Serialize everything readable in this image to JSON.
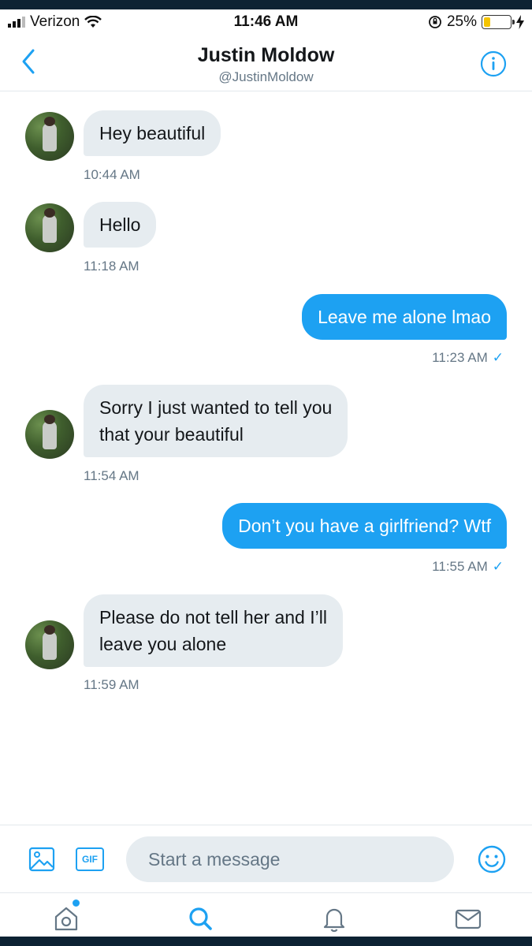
{
  "status_bar": {
    "carrier": "Verizon",
    "time": "11:46 AM",
    "battery": "25%",
    "battery_level": 0.25
  },
  "header": {
    "name": "Justin Moldow",
    "handle": "@JustinMoldow"
  },
  "messages": [
    {
      "direction": "in",
      "text_lines": [
        "Hey beautiful"
      ],
      "time": "10:44 AM"
    },
    {
      "direction": "in",
      "text_lines": [
        "Hello"
      ],
      "time": "11:18 AM"
    },
    {
      "direction": "out",
      "text_lines": [
        "Leave me alone lmao"
      ],
      "time": "11:23 AM",
      "read": true
    },
    {
      "direction": "in",
      "text_lines": [
        "Sorry I just wanted to tell you",
        "that your beautiful"
      ],
      "time": "11:54 AM"
    },
    {
      "direction": "out",
      "text_lines": [
        "Don’t you have a girlfriend? Wtf"
      ],
      "time": "11:55 AM",
      "read": true
    },
    {
      "direction": "in",
      "text_lines": [
        "Please do not tell her and I’ll",
        "leave you alone"
      ],
      "time": "11:59 AM"
    }
  ],
  "composer": {
    "gif_label": "GIF",
    "placeholder": "Start a message"
  },
  "tabs": [
    {
      "name": "home-tab",
      "icon": "home-icon",
      "notification_dot": true
    },
    {
      "name": "search-tab",
      "icon": "search-icon"
    },
    {
      "name": "notifications-tab",
      "icon": "bell-icon"
    },
    {
      "name": "messages-tab",
      "icon": "mail-icon"
    }
  ],
  "colors": {
    "accent": "#1da1f2",
    "incoming_bubble": "#e6ecf0",
    "text_primary": "#14171a",
    "text_secondary": "#657786"
  },
  "read_mark": "✓"
}
